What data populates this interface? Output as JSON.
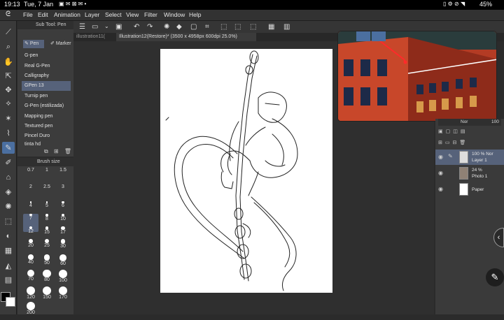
{
  "status": {
    "time": "19:13",
    "date": "Tue, 7 Jan",
    "battery": "45%"
  },
  "menu": [
    "File",
    "Edit",
    "Animation",
    "Layer",
    "Select",
    "View",
    "Filter",
    "Window",
    "Help"
  ],
  "subtool": {
    "header": "Sub Tool: Pen",
    "tabs": [
      "Pen",
      "Marker"
    ],
    "items": [
      "G-pen",
      "Real G-Pen",
      "Calligraphy",
      "GPen 13",
      "Turnip pen",
      "G-Pen (estilizada)",
      "Mapping pen",
      "Textured pen",
      "Pincel Duro",
      "tinta hd"
    ],
    "selected_index": 3
  },
  "brush_size": {
    "header": "Brush size",
    "sizes": [
      "0.7",
      "1",
      "1.5",
      "2",
      "2.5",
      "3",
      "4",
      "5",
      "6",
      "7",
      "8",
      "10",
      "12",
      "15",
      "17",
      "20",
      "25",
      "30",
      "40",
      "50",
      "60",
      "70",
      "80",
      "100",
      "120",
      "150",
      "170",
      "200"
    ],
    "selected": "7"
  },
  "tabs": {
    "tab1": "illustration11(",
    "tab2": "Illustration12(Restore)* (3500 x 4958px 600dpi 25.0%)"
  },
  "layers": {
    "opacity_value": "100",
    "rows": [
      {
        "label1": "100 % Nor",
        "label2": "Layer 1"
      },
      {
        "label1": "24 %",
        "label2": "Photo 1"
      },
      {
        "label1": "Paper",
        "label2": ""
      }
    ],
    "blend_label": "Nor"
  },
  "colors": {
    "accent": "#4b6fa0",
    "selection": "#56627a",
    "ref_brick": "#a6321e"
  }
}
